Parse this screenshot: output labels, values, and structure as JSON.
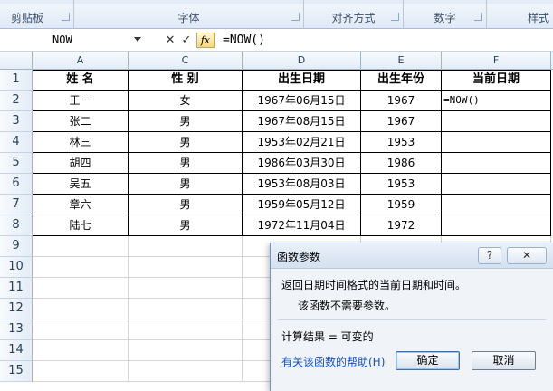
{
  "ribbon": {
    "groups": [
      {
        "label": "剪贴板"
      },
      {
        "label": "字体"
      },
      {
        "label": "对齐方式"
      },
      {
        "label": "数字"
      },
      {
        "label": "样式"
      }
    ]
  },
  "formula_bar": {
    "name_box": "NOW",
    "cancel_icon": "✕",
    "enter_icon": "✓",
    "fx_label": "fx",
    "formula": "=NOW()"
  },
  "sheet": {
    "columns": [
      "A",
      "C",
      "D",
      "E",
      "F"
    ],
    "rows": [
      "1",
      "2",
      "3",
      "4",
      "5",
      "6",
      "7",
      "8",
      "9",
      "10",
      "11",
      "12",
      "13",
      "14",
      "15"
    ],
    "header": [
      "姓 名",
      "性 别",
      "出生日期",
      "出生年份",
      "当前日期"
    ],
    "data": [
      [
        "王一",
        "女",
        "1967年06月15日",
        "1967",
        "=NOW()"
      ],
      [
        "张二",
        "男",
        "1967年08月15日",
        "1967",
        ""
      ],
      [
        "林三",
        "男",
        "1953年02月21日",
        "1953",
        ""
      ],
      [
        "胡四",
        "男",
        "1986年03月30日",
        "1986",
        ""
      ],
      [
        "吴五",
        "男",
        "1953年08月03日",
        "1953",
        ""
      ],
      [
        "章六",
        "男",
        "1959年05月12日",
        "1959",
        ""
      ],
      [
        "陆七",
        "男",
        "1972年11月04日",
        "1972",
        ""
      ]
    ]
  },
  "dialog": {
    "title": "函数参数",
    "help_btn": "?",
    "close_btn": "✕",
    "description": "返回日期时间格式的当前日期和时间。",
    "no_args": "该函数不需要参数。",
    "result": "计算结果 =  可变的",
    "help_link": "有关该函数的帮助(H)",
    "ok": "确定",
    "cancel": "取消"
  }
}
